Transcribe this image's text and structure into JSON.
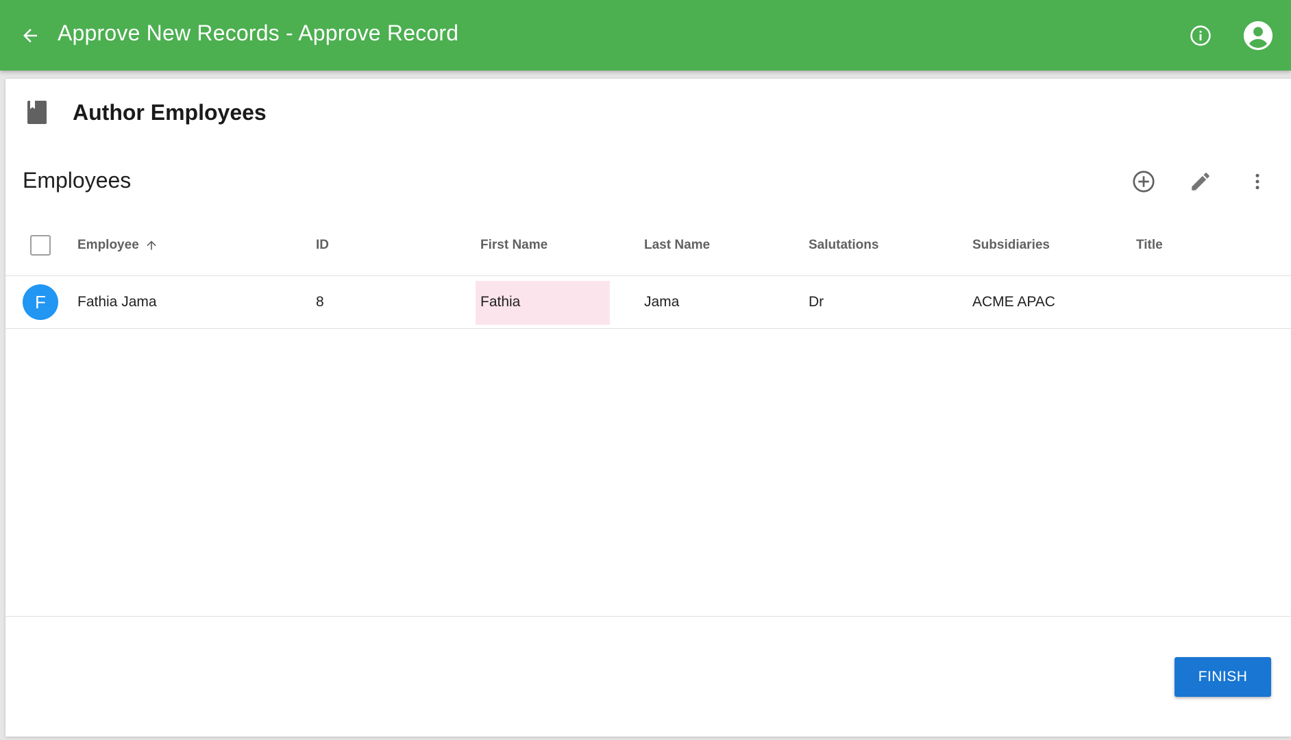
{
  "appbar": {
    "title": "Approve New Records - Approve Record",
    "icons": {
      "back": "arrow-back-icon",
      "info": "info-icon",
      "account": "account-circle-icon"
    },
    "color": "#4caf50"
  },
  "card": {
    "heading": "Author Employees",
    "heading_icon": "book-icon"
  },
  "section": {
    "title": "Employees",
    "actions": [
      "add-circle-icon",
      "edit-icon",
      "more-vert-icon"
    ]
  },
  "table": {
    "columns": [
      "Employee",
      "ID",
      "First Name",
      "Last Name",
      "Salutations",
      "Subsidiaries",
      "Title"
    ],
    "sort_column": "Employee",
    "sort_direction": "ascending",
    "rows": [
      {
        "avatar": "F",
        "employee": "Fathia Jama",
        "id": "8",
        "first_name": "Fathia",
        "last_name": "Jama",
        "salutation": "Dr",
        "subsidiary": "ACME APAC",
        "title": ""
      }
    ]
  },
  "footer": {
    "finish_label": "FINISH",
    "accent": "#1976d2"
  }
}
